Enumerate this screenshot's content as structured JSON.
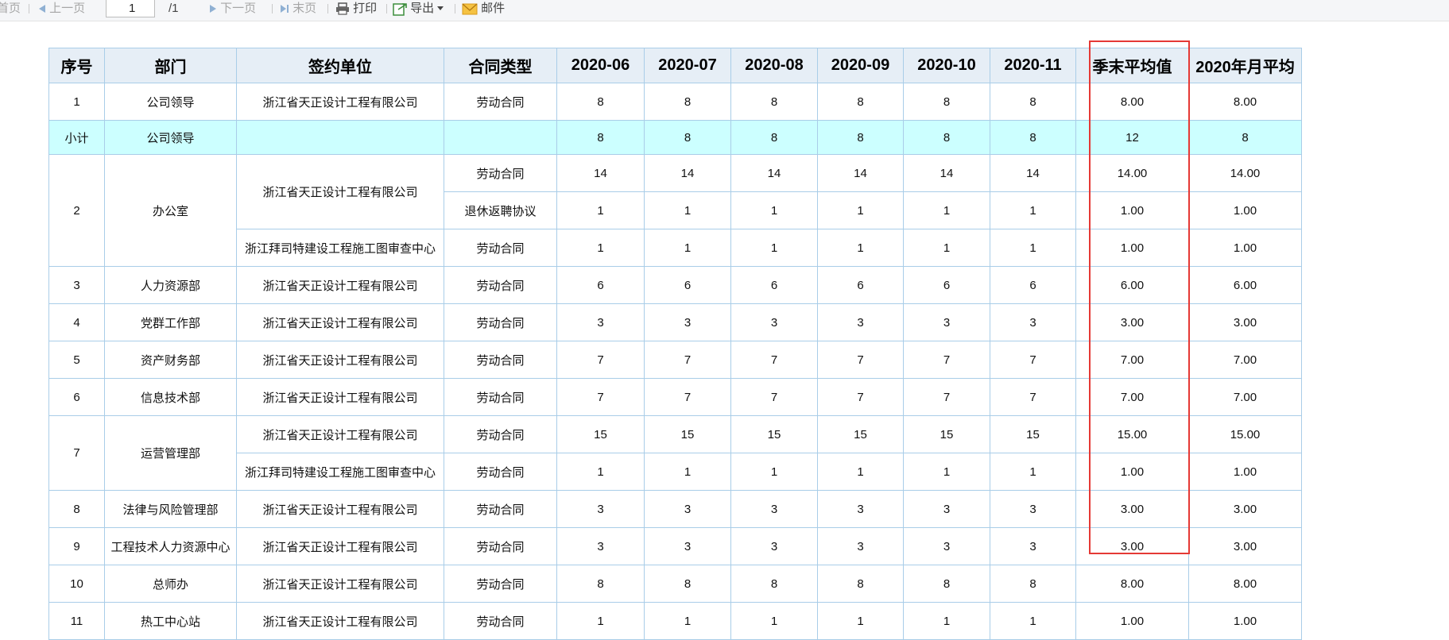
{
  "toolbar": {
    "first_page": "首页",
    "prev_page": "上一页",
    "page_input": "1",
    "page_total": "/1",
    "next_page": "下一页",
    "last_page": "末页",
    "print": "打印",
    "export": "导出",
    "mail": "邮件"
  },
  "table": {
    "headers": {
      "index": "序号",
      "dept": "部门",
      "unit": "签约单位",
      "type": "合同类型",
      "m1": "2020-06",
      "m2": "2020-07",
      "m3": "2020-08",
      "m4": "2020-09",
      "m5": "2020-10",
      "m6": "2020-11",
      "quarter_avg": "季末平均值",
      "year_avg": "2020年月平均"
    },
    "rows": [
      {
        "index": "1",
        "dept": "公司领导",
        "unit": "浙江省天正设计工程有限公司",
        "type": "劳动合同",
        "vals": [
          "8",
          "8",
          "8",
          "8",
          "8",
          "8"
        ],
        "qavg": "8.00",
        "yavg": "8.00"
      },
      {
        "index": "小计",
        "dept": "公司领导",
        "unit": "",
        "type": "",
        "vals": [
          "8",
          "8",
          "8",
          "8",
          "8",
          "8"
        ],
        "qavg": "12",
        "yavg": "8"
      },
      {
        "index": "2",
        "dept": "办公室",
        "unit": "浙江省天正设计工程有限公司",
        "type": "劳动合同",
        "vals": [
          "14",
          "14",
          "14",
          "14",
          "14",
          "14"
        ],
        "qavg": "14.00",
        "yavg": "14.00"
      },
      {
        "type": "退休返聘协议",
        "vals": [
          "1",
          "1",
          "1",
          "1",
          "1",
          "1"
        ],
        "qavg": "1.00",
        "yavg": "1.00"
      },
      {
        "unit": "浙江拜司特建设工程施工图审查中心",
        "type": "劳动合同",
        "vals": [
          "1",
          "1",
          "1",
          "1",
          "1",
          "1"
        ],
        "qavg": "1.00",
        "yavg": "1.00"
      },
      {
        "index": "3",
        "dept": "人力资源部",
        "unit": "浙江省天正设计工程有限公司",
        "type": "劳动合同",
        "vals": [
          "6",
          "6",
          "6",
          "6",
          "6",
          "6"
        ],
        "qavg": "6.00",
        "yavg": "6.00"
      },
      {
        "index": "4",
        "dept": "党群工作部",
        "unit": "浙江省天正设计工程有限公司",
        "type": "劳动合同",
        "vals": [
          "3",
          "3",
          "3",
          "3",
          "3",
          "3"
        ],
        "qavg": "3.00",
        "yavg": "3.00"
      },
      {
        "index": "5",
        "dept": "资产财务部",
        "unit": "浙江省天正设计工程有限公司",
        "type": "劳动合同",
        "vals": [
          "7",
          "7",
          "7",
          "7",
          "7",
          "7"
        ],
        "qavg": "7.00",
        "yavg": "7.00"
      },
      {
        "index": "6",
        "dept": "信息技术部",
        "unit": "浙江省天正设计工程有限公司",
        "type": "劳动合同",
        "vals": [
          "7",
          "7",
          "7",
          "7",
          "7",
          "7"
        ],
        "qavg": "7.00",
        "yavg": "7.00"
      },
      {
        "index": "7",
        "dept": "运营管理部",
        "unit": "浙江省天正设计工程有限公司",
        "type": "劳动合同",
        "vals": [
          "15",
          "15",
          "15",
          "15",
          "15",
          "15"
        ],
        "qavg": "15.00",
        "yavg": "15.00"
      },
      {
        "unit": "浙江拜司特建设工程施工图审查中心",
        "type": "劳动合同",
        "vals": [
          "1",
          "1",
          "1",
          "1",
          "1",
          "1"
        ],
        "qavg": "1.00",
        "yavg": "1.00"
      },
      {
        "index": "8",
        "dept": "法律与风险管理部",
        "unit": "浙江省天正设计工程有限公司",
        "type": "劳动合同",
        "vals": [
          "3",
          "3",
          "3",
          "3",
          "3",
          "3"
        ],
        "qavg": "3.00",
        "yavg": "3.00"
      },
      {
        "index": "9",
        "dept": "工程技术人力资源中心",
        "unit": "浙江省天正设计工程有限公司",
        "type": "劳动合同",
        "vals": [
          "3",
          "3",
          "3",
          "3",
          "3",
          "3"
        ],
        "qavg": "3.00",
        "yavg": "3.00"
      },
      {
        "index": "10",
        "dept": "总师办",
        "unit": "浙江省天正设计工程有限公司",
        "type": "劳动合同",
        "vals": [
          "8",
          "8",
          "8",
          "8",
          "8",
          "8"
        ],
        "qavg": "8.00",
        "yavg": "8.00"
      },
      {
        "index": "11",
        "dept": "热工中心站",
        "unit": "浙江省天正设计工程有限公司",
        "type": "劳动合同",
        "vals": [
          "1",
          "1",
          "1",
          "1",
          "1",
          "1"
        ],
        "qavg": "1.00",
        "yavg": "1.00"
      }
    ]
  },
  "colors": {
    "header_bg": "#e6eef6",
    "subtotal_bg": "#ccffff",
    "grid": "#a9cde8",
    "highlight": "#e53935"
  }
}
